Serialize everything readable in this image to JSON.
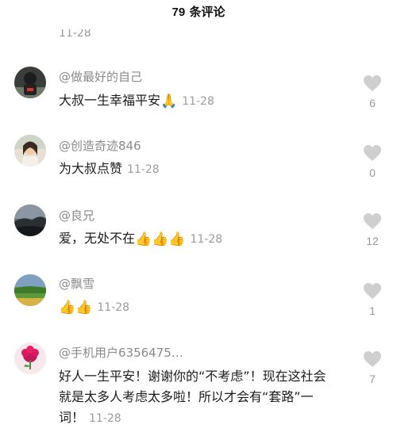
{
  "header": {
    "count": "79",
    "title": "条评论"
  },
  "previous_time": "11-28",
  "comments": [
    {
      "username": "@做最好的自己",
      "text": "大叔一生幸福平安",
      "emoji": "🙏",
      "time": "11-28",
      "likes": "6",
      "avatar_icon": "avatar-dark-portrait"
    },
    {
      "username": "@创造奇迹846",
      "text": "为大叔点赞",
      "emoji": "",
      "time": "11-28",
      "likes": "0",
      "avatar_icon": "avatar-woman-portrait"
    },
    {
      "username": "@良兄",
      "text": "爱，无处不在",
      "emoji": "👍👍👍",
      "time": "11-28",
      "likes": "12",
      "avatar_icon": "avatar-sunset-landscape"
    },
    {
      "username": "@飘雪",
      "text": "",
      "emoji": "👍👍",
      "time": "11-28",
      "likes": "1",
      "avatar_icon": "avatar-green-landscape"
    },
    {
      "username": "@手机用户6356475…",
      "text": "好人一生平安！谢谢你的“不考虑”！现在这社会就是太多人考虑太多啦！所以才会有“套路”一词！",
      "emoji": "",
      "time": "11-28",
      "likes": "7",
      "avatar_icon": "avatar-flower"
    }
  ],
  "colors": {
    "heart": "#cfcfcf",
    "username": "#8a8a8a",
    "timestamp": "#9c9c9c"
  }
}
